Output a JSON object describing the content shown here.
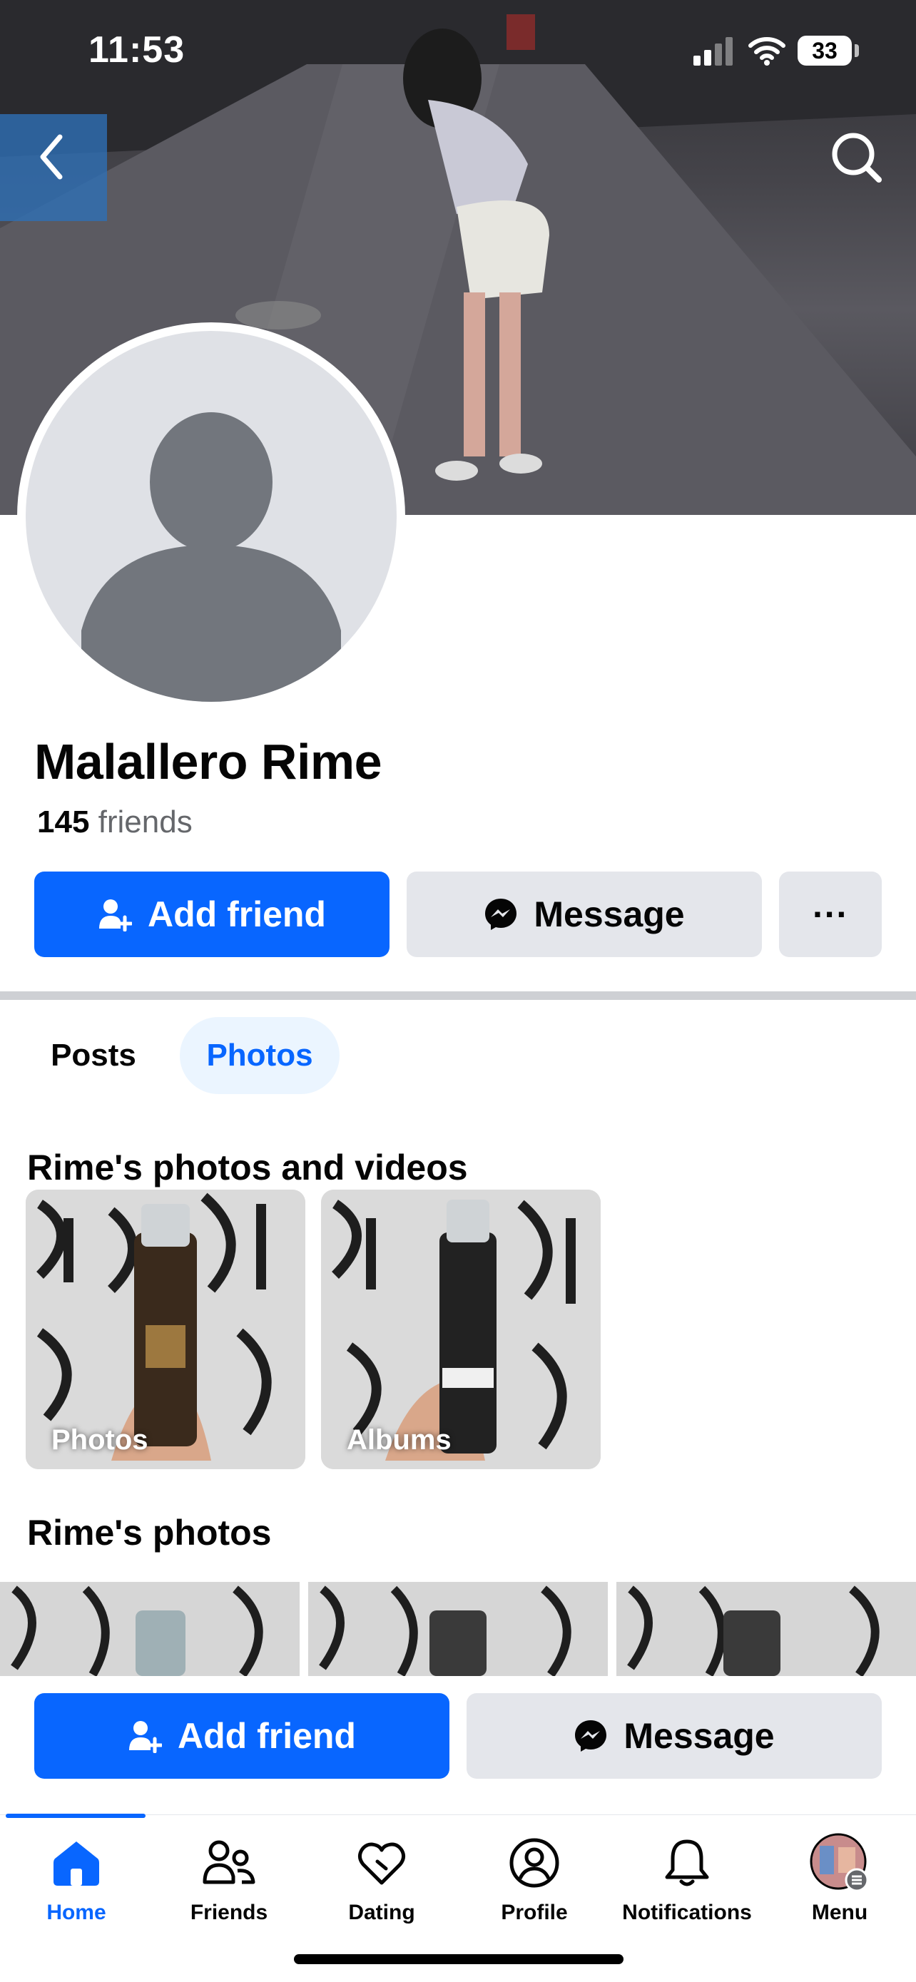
{
  "status_bar": {
    "time": "11:53",
    "battery": "33"
  },
  "profile": {
    "name": "Malallero Rime",
    "friends_count": "145",
    "friends_label": "friends"
  },
  "actions": {
    "add_friend": "Add friend",
    "message": "Message",
    "more": "···"
  },
  "tabs": [
    {
      "label": "Posts"
    },
    {
      "label": "Photos"
    }
  ],
  "sections": {
    "photos_and_videos_title": "Rime's photos and videos",
    "photos_title": "Rime's photos"
  },
  "tiles": [
    {
      "label": "Photos"
    },
    {
      "label": "Albums"
    }
  ],
  "bottom_actions": {
    "add_friend": "Add friend",
    "message": "Message"
  },
  "nav": [
    {
      "label": "Home",
      "icon": "home-icon"
    },
    {
      "label": "Friends",
      "icon": "friends-icon"
    },
    {
      "label": "Dating",
      "icon": "dating-icon"
    },
    {
      "label": "Profile",
      "icon": "profile-icon"
    },
    {
      "label": "Notifications",
      "icon": "bell-icon"
    },
    {
      "label": "Menu",
      "icon": "menu-avatar-icon"
    }
  ],
  "colors": {
    "accent": "#0866ff",
    "secondary_button": "#e4e6eb",
    "tab_active_bg": "#ebf5ff",
    "muted_text": "#65676b"
  }
}
